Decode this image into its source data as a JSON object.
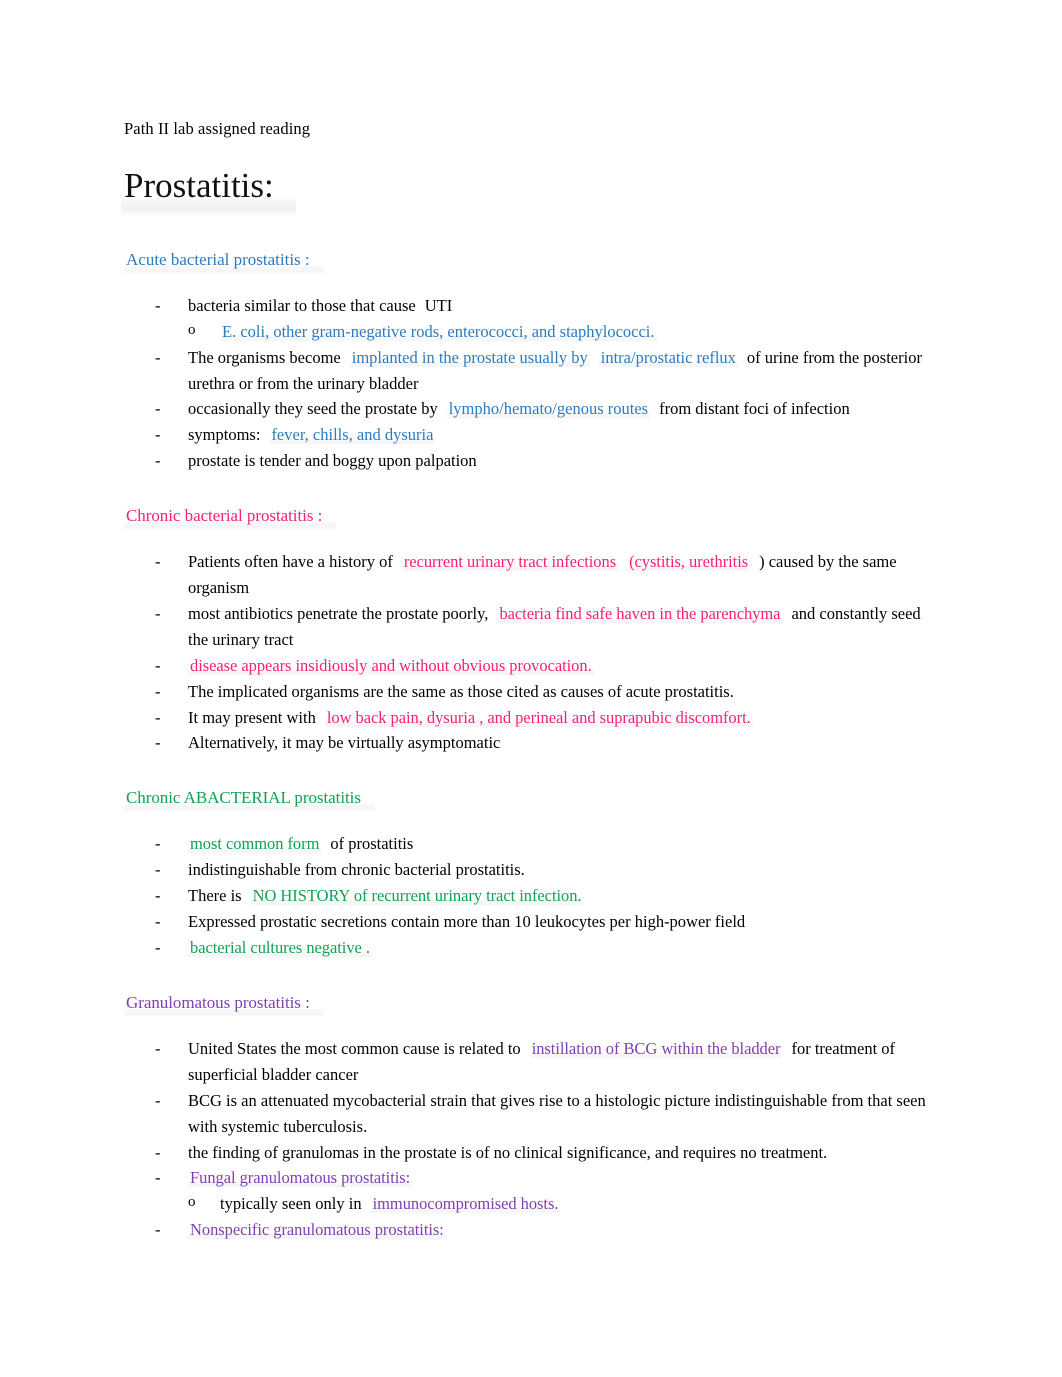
{
  "document": {
    "running_head": "Path II lab assigned reading",
    "title": "Prostatitis:"
  },
  "colors": {
    "blue": "#2A7BC0",
    "pink": "#F81F76",
    "green": "#10A254",
    "purple": "#7F3FB3",
    "black": "#000000",
    "page_background": "#FFFFFF"
  },
  "sections": [
    {
      "id": "acute-bacterial-prostatitis",
      "heading": "Acute bacterial prostatitis :",
      "heading_color": "blue",
      "bullets": [
        {
          "runs": [
            {
              "text": "bacteria similar to those that cause",
              "color": "black"
            },
            {
              "text": "UTI",
              "color": "black"
            }
          ],
          "sub_bullets": [
            {
              "runs": [
                {
                  "text": "E. coli, other gram-negative rods, enterococci, and staphylococci.",
                  "color": "blue"
                }
              ]
            }
          ]
        },
        {
          "runs": [
            {
              "text": "The organisms become",
              "color": "black"
            },
            {
              "text": "implanted in the prostate usually by",
              "color": "blue"
            },
            {
              "text": "intra/prostatic reflux",
              "color": "blue"
            },
            {
              "text": "of urine from the posterior urethra or from the urinary bladder",
              "color": "black"
            }
          ]
        },
        {
          "runs": [
            {
              "text": "occasionally they seed the prostate by",
              "color": "black"
            },
            {
              "text": "lympho/hemato/genous routes",
              "color": "blue"
            },
            {
              "text": "from distant foci of infection",
              "color": "black"
            }
          ]
        },
        {
          "runs": [
            {
              "text": "symptoms:",
              "color": "black"
            },
            {
              "text": "fever, chills, and dysuria",
              "color": "blue"
            }
          ]
        },
        {
          "runs": [
            {
              "text": "prostate is tender and boggy upon palpation",
              "color": "black"
            }
          ]
        }
      ]
    },
    {
      "id": "chronic-bacterial-prostatitis",
      "heading": "Chronic bacterial prostatitis :",
      "heading_color": "pink",
      "bullets": [
        {
          "runs": [
            {
              "text": "Patients often have a history of",
              "color": "black"
            },
            {
              "text": "recurrent urinary tract infections",
              "color": "pink"
            },
            {
              "text": "(cystitis, urethritis",
              "color": "pink"
            },
            {
              "text": ") caused by the same organism",
              "color": "black"
            }
          ]
        },
        {
          "runs": [
            {
              "text": "most antibiotics penetrate the prostate poorly,",
              "color": "black"
            },
            {
              "text": "bacteria find safe haven in the parenchyma",
              "color": "pink"
            },
            {
              "text": "and constantly seed the urinary tract",
              "color": "black"
            }
          ]
        },
        {
          "runs": [
            {
              "text": "disease appears insidiously and without obvious provocation.",
              "color": "pink"
            }
          ]
        },
        {
          "runs": [
            {
              "text": "The implicated organisms are the same as those cited as causes of acute prostatitis.",
              "color": "black"
            }
          ]
        },
        {
          "runs": [
            {
              "text": "It may present with",
              "color": "black"
            },
            {
              "text": "low back pain, dysuria , and perineal and suprapubic discomfort.",
              "color": "pink"
            }
          ]
        },
        {
          "runs": [
            {
              "text": "Alternatively, it may be virtually asymptomatic",
              "color": "black"
            }
          ]
        }
      ]
    },
    {
      "id": "chronic-abacterial-prostatitis",
      "heading": "Chronic ABACTERIAL prostatitis",
      "heading_color": "green",
      "bullets": [
        {
          "runs": [
            {
              "text": "most common form",
              "color": "green"
            },
            {
              "text": "of prostatitis",
              "color": "black"
            }
          ]
        },
        {
          "runs": [
            {
              "text": "indistinguishable from chronic bacterial prostatitis.",
              "color": "black"
            }
          ]
        },
        {
          "runs": [
            {
              "text": "There is",
              "color": "black"
            },
            {
              "text": "NO HISTORY of recurrent urinary tract infection.",
              "color": "green"
            }
          ]
        },
        {
          "runs": [
            {
              "text": "Expressed prostatic secretions contain more than 10 leukocytes per high-power field",
              "color": "black"
            }
          ]
        },
        {
          "runs": [
            {
              "text": "bacterial cultures negative .",
              "color": "green"
            }
          ]
        }
      ]
    },
    {
      "id": "granulomatous-prostatitis",
      "heading": "Granulomatous prostatitis :",
      "heading_color": "purple",
      "bullets": [
        {
          "runs": [
            {
              "text": "United States the most common cause is related to",
              "color": "black"
            },
            {
              "text": "instillation of BCG within the bladder",
              "color": "purple"
            },
            {
              "text": "for treatment of superficial bladder cancer",
              "color": "black"
            }
          ]
        },
        {
          "runs": [
            {
              "text": "BCG is an attenuated mycobacterial strain that gives rise to a histologic picture indistinguishable from that seen with systemic tuberculosis.",
              "color": "black"
            }
          ]
        },
        {
          "runs": [
            {
              "text": "the finding of granulomas in the prostate is of no clinical significance, and requires no treatment.",
              "color": "black"
            }
          ]
        },
        {
          "runs": [
            {
              "text": "Fungal granulomatous prostatitis:",
              "color": "purple"
            }
          ],
          "sub_bullets": [
            {
              "runs": [
                {
                  "text": "typically seen only in",
                  "color": "black"
                },
                {
                  "text": "immunocompromised hosts.",
                  "color": "purple"
                }
              ]
            }
          ]
        },
        {
          "runs": [
            {
              "text": "Nonspecific granulomatous prostatitis:",
              "color": "purple"
            }
          ]
        }
      ]
    }
  ]
}
